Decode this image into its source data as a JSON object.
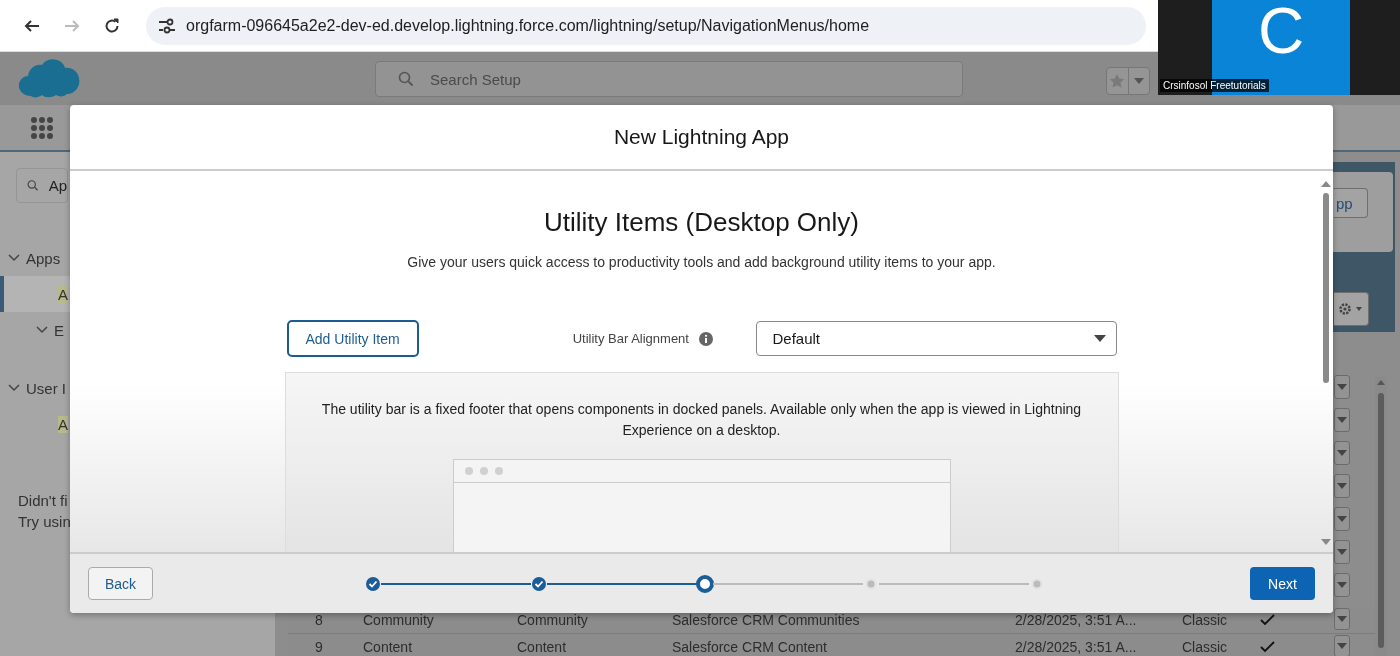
{
  "browser": {
    "url": "orgfarm-096645a2e2-dev-ed.develop.lightning.force.com/lightning/setup/NavigationMenus/home",
    "forward_disabled": true
  },
  "header": {
    "search_placeholder": "Search Setup"
  },
  "video_tile": {
    "initial": "C",
    "name": "Crsinfosol Freetutorials"
  },
  "sidebar": {
    "search_value": "Ap",
    "items": [
      {
        "label": "Apps",
        "kind": "section",
        "selected": false
      },
      {
        "label": "A",
        "kind": "link",
        "selected": true
      },
      {
        "label": "E",
        "kind": "subsection",
        "selected": false
      },
      {
        "label": "User I",
        "kind": "section",
        "selected": false
      },
      {
        "label": "A",
        "kind": "link",
        "selected": false
      }
    ],
    "help_lines": [
      "Didn't fi",
      "Try usin"
    ]
  },
  "content": {
    "new_button": "pp"
  },
  "table": {
    "rows": [
      {
        "cells": [
          "8",
          "Community",
          "Community",
          "Salesforce CRM Communities",
          "2/28/2025, 3:51 A...",
          "Classic"
        ],
        "checked": true
      },
      {
        "cells": [
          "9",
          "Content",
          "Content",
          "Salesforce CRM Content",
          "2/28/2025, 3:51 A...",
          "Classic"
        ],
        "checked": true
      }
    ]
  },
  "modal": {
    "title": "New Lightning App",
    "heading": "Utility Items (Desktop Only)",
    "subtitle": "Give your users quick access to productivity tools and add background utility items to your app.",
    "add_button": "Add Utility Item",
    "alignment_label": "Utility Bar Alignment",
    "alignment_value": "Default",
    "info_text": "The utility bar is a fixed footer that opens components in docked panels. Available only when the app is viewed in Lightning Experience on a desktop.",
    "back_button": "Back",
    "next_button": "Next",
    "steps": [
      {
        "completed": true,
        "active": false
      },
      {
        "completed": true,
        "active": false
      },
      {
        "completed": false,
        "active": true
      },
      {
        "completed": false,
        "active": false
      },
      {
        "completed": false,
        "active": false
      }
    ]
  }
}
